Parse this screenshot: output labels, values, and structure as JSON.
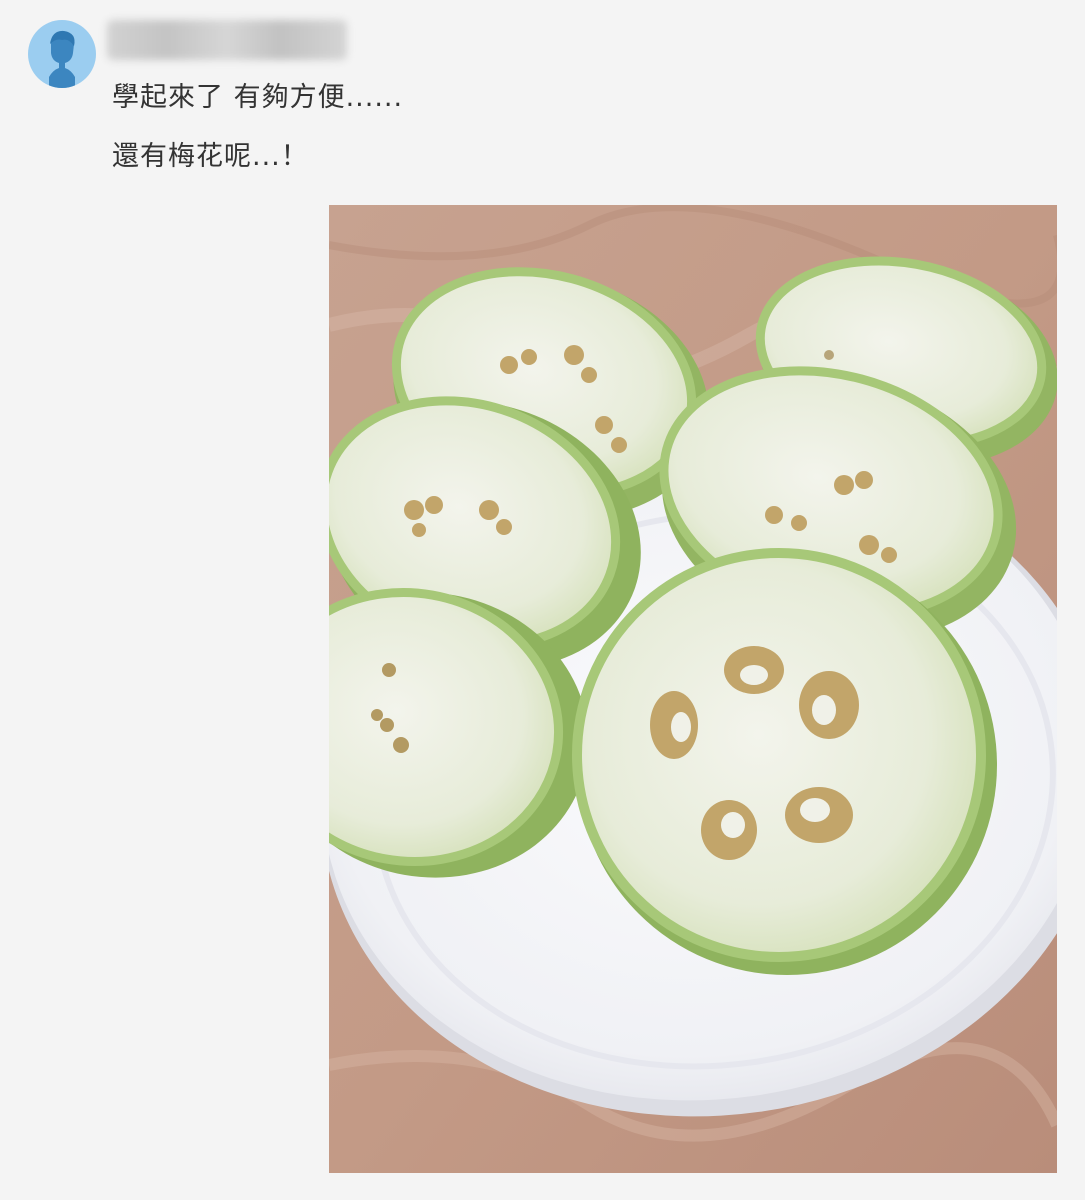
{
  "comment": {
    "user": {
      "avatar_icon": "user-silhouette-icon",
      "avatar_color": "#9bcdf0"
    },
    "lines": [
      "學起來了 有夠方便......",
      "還有梅花呢...！"
    ],
    "photo": {
      "fruit_slice_count": 6,
      "flesh_color": "#eef1e6",
      "rind_color": "#9cc06a",
      "seed_color": "#c2a56a",
      "plate_color": "#f6f7fb",
      "table_color": "#c9a08d"
    }
  }
}
